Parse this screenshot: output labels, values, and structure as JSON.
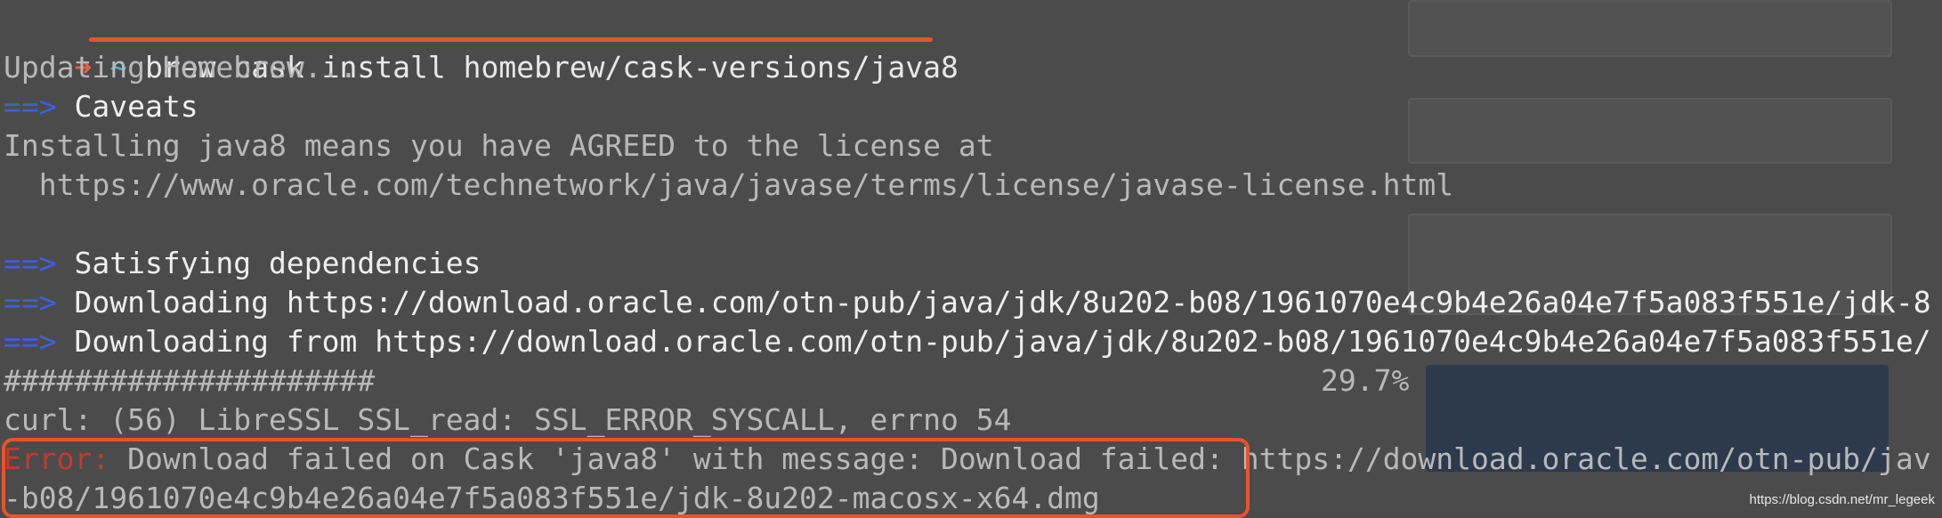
{
  "terminal": {
    "prompt_arrow": "➜",
    "prompt_dir": "~",
    "command": "brew cask install homebrew/cask-versions/java8",
    "lines": {
      "updating": "Updating Homebrew...",
      "caveats_marker": "==>",
      "caveats": "Caveats",
      "license_1": "Installing java8 means you have AGREED to the license at",
      "license_2": "  https://www.oracle.com/technetwork/java/javase/terms/license/javase-license.html",
      "deps_marker": "==>",
      "deps": "Satisfying dependencies",
      "dl1_marker": "==>",
      "dl1": "Downloading https://download.oracle.com/otn-pub/java/jdk/8u202-b08/1961070e4c9b4e26a04e7f5a083f551e/jdk-8",
      "dl2_marker": "==>",
      "dl2": "Downloading from https://download.oracle.com/otn-pub/java/jdk/8u202-b08/1961070e4c9b4e26a04e7f5a083f551e/",
      "progress_bar": "#####################",
      "progress_percent": "29.7%",
      "curl_error": "curl: (56) LibreSSL SSL_read: SSL_ERROR_SYSCALL, errno 54",
      "error_label": "Error:",
      "error_message": " Download failed on Cask 'java8' with message: Download failed: https://download.oracle.com/otn-pub/jav",
      "error_cont": "-b08/1961070e4c9b4e26a04e7f5a083f551e/jdk-8u202-macosx-x64.dmg"
    },
    "progress_fraction": 0.297
  },
  "watermark": "https://blog.csdn.net/mr_legeek",
  "colors": {
    "background": "#4b4b4b",
    "marker": "#3d5fe3",
    "highlight": "#e5542b",
    "prompt_arrow": "#ea5d45",
    "prompt_dir": "#46b5c0"
  }
}
